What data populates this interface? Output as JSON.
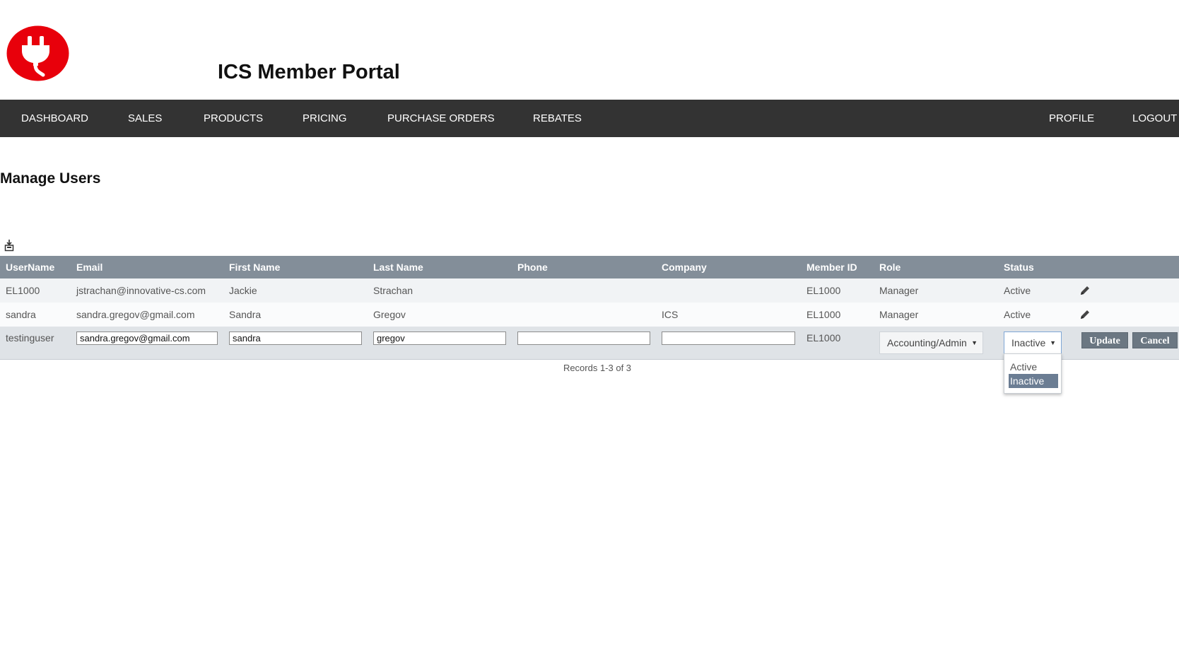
{
  "header": {
    "logo_alt": "plug logo",
    "title": "ICS Member Portal",
    "brand_color": "#e8000b"
  },
  "nav": {
    "items": [
      {
        "label": "DASHBOARD"
      },
      {
        "label": "SALES"
      },
      {
        "label": "PRODUCTS"
      },
      {
        "label": "PRICING"
      },
      {
        "label": "PURCHASE ORDERS"
      },
      {
        "label": "REBATES"
      }
    ],
    "right_items": [
      {
        "label": "PROFILE"
      },
      {
        "label": "LOGOUT"
      }
    ]
  },
  "page": {
    "title": "Manage Users",
    "export_icon": "export-icon"
  },
  "table": {
    "columns": [
      "UserName",
      "Email",
      "First Name",
      "Last Name",
      "Phone",
      "Company",
      "Member ID",
      "Role",
      "Status"
    ],
    "rows": [
      {
        "username": "EL1000",
        "email": "jstrachan@innovative-cs.com",
        "first_name": "Jackie",
        "last_name": "Strachan",
        "phone": "",
        "company": "",
        "member_id": "EL1000",
        "role": "Manager",
        "status": "Active",
        "action_icon": "pencil-icon"
      },
      {
        "username": "sandra",
        "email": "sandra.gregov@gmail.com",
        "first_name": "Sandra",
        "last_name": "Gregov",
        "phone": "",
        "company": "ICS",
        "member_id": "EL1000",
        "role": "Manager",
        "status": "Active",
        "action_icon": "pencil-icon"
      }
    ],
    "edit_row": {
      "username": "testinguser",
      "email": "sandra.gregov@gmail.com",
      "first_name": "sandra",
      "last_name": "gregov",
      "phone": "",
      "company": "",
      "member_id": "EL1000",
      "role": "Accounting/Admin",
      "status": "Inactive",
      "update_label": "Update",
      "cancel_label": "Cancel"
    },
    "status_options": [
      "Active",
      "Inactive"
    ],
    "status_selected": "Inactive"
  },
  "pager": {
    "records_text": "Records 1-3 of 3"
  }
}
